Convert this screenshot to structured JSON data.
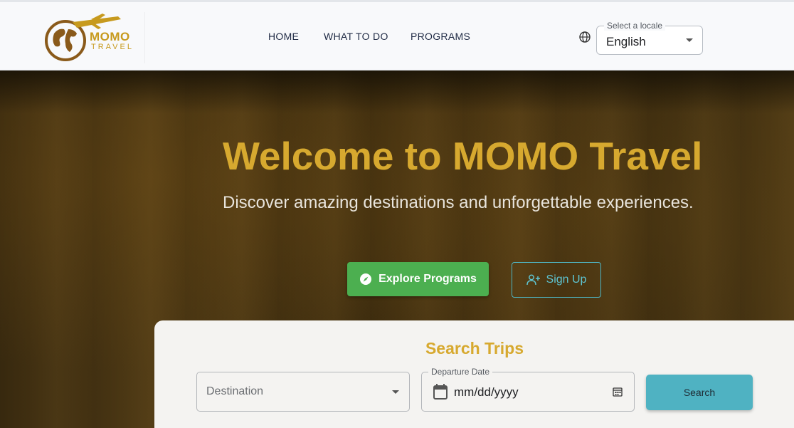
{
  "brand": {
    "name_line1": "MOMO",
    "name_line2": "TRAVEL",
    "color": "#c79a1e"
  },
  "nav": {
    "home": "HOME",
    "what_to_do": "WHAT TO DO",
    "programs": "PROGRAMS"
  },
  "locale": {
    "label": "Select a locale",
    "value": "English",
    "icon": "globe-icon"
  },
  "hero": {
    "title": "Welcome to MOMO Travel",
    "subtitle": "Discover amazing destinations and unforgettable experiences.",
    "explore_label": "Explore Programs",
    "explore_icon": "compass-icon",
    "signup_label": "Sign Up",
    "signup_icon": "person-add-icon"
  },
  "search": {
    "title": "Search Trips",
    "destination_placeholder": "Destination",
    "date_label": "Departure Date",
    "date_value": "mm/dd/yyyy",
    "button_label": "Search"
  },
  "colors": {
    "accent_gold": "#d7a92f",
    "explore_green": "#4caf50",
    "teal": "#4fb2c2"
  }
}
